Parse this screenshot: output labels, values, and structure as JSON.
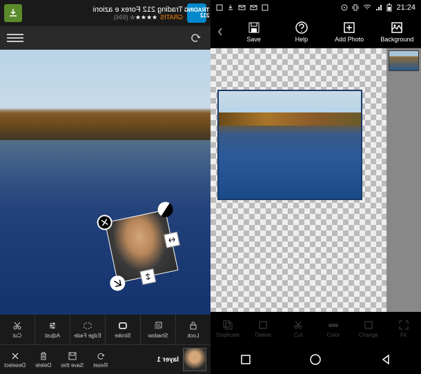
{
  "left": {
    "ad": {
      "badge": "TRADING 212",
      "title": "Trading 212 Forex e azioni",
      "gratis": "GRATIS",
      "stars": "★★★★☆",
      "count": "(694)"
    },
    "tools_top": {
      "lock": "Lock",
      "shadow": "Shadow",
      "stroke": "Stroke",
      "edge_fade": "Edge Fade",
      "adjust": "Adjust",
      "cut": "Cut"
    },
    "tools_bottom": {
      "layer": "layer 1",
      "reset": "Reset",
      "save_this": "Save this",
      "delete": "Delete",
      "deselect": "Deselect"
    }
  },
  "right": {
    "status": {
      "time": "21:24"
    },
    "toolbar": {
      "save": "Save",
      "help": "Help",
      "add_photo": "Add Photo",
      "background": "Background"
    },
    "bottom_tools": {
      "t1": "Duplicate",
      "t2": "Delete",
      "t3": "Cut",
      "t4": "Color",
      "t5": "Change",
      "t6": "Fit"
    }
  }
}
